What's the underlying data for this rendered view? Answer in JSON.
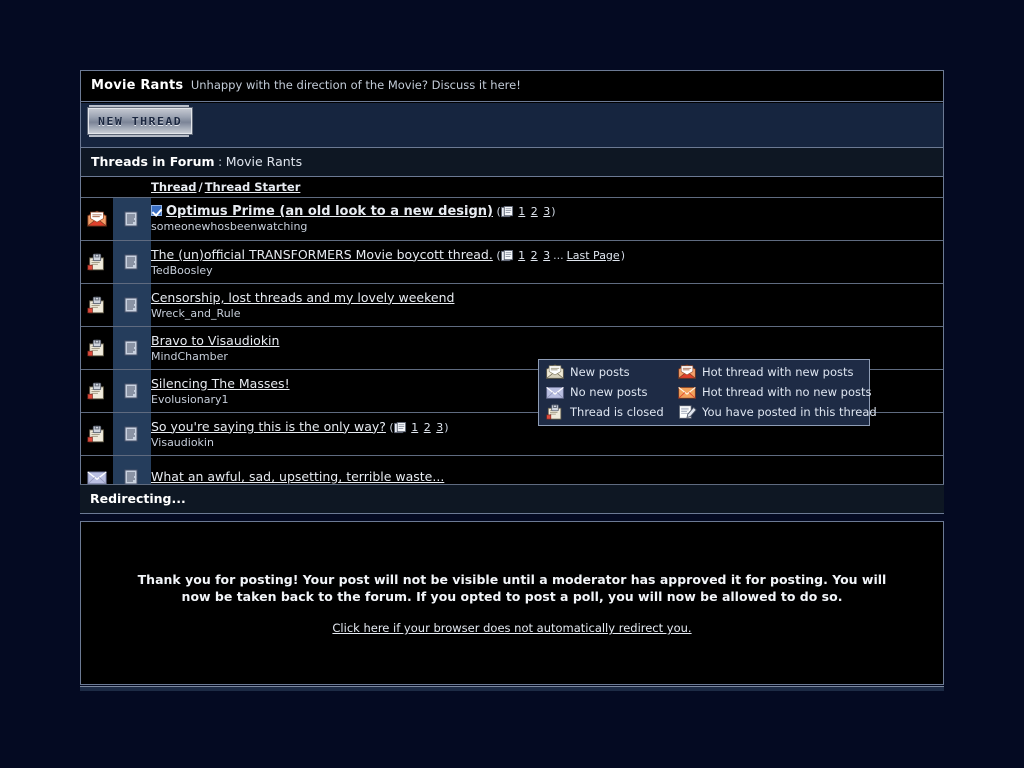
{
  "forum": {
    "name": "Movie Rants",
    "description": "Unhappy with the direction of the Movie? Discuss it here!",
    "new_thread_button": "NEW THREAD",
    "threads_header_label": "Threads in Forum",
    "threads_header_separator": ":",
    "threads_header_forum": "Movie Rants",
    "columns": {
      "thread": "Thread",
      "separator": "/",
      "thread_starter": "Thread Starter"
    },
    "threads": [
      {
        "status_icon": "hot-thread-new-posts-icon",
        "multipage_icon": "multipage-icon",
        "has_checkbox": true,
        "bold": true,
        "title": "Optimus Prime (an old look to a new design)",
        "starter": "someonewhosbeenwatching",
        "pages": [
          "1",
          "2",
          "3"
        ],
        "last_page": null
      },
      {
        "status_icon": "thread-closed-icon",
        "multipage_icon": "multipage-icon",
        "has_checkbox": false,
        "bold": false,
        "title": "The (un)official TRANSFORMERS Movie boycott thread.",
        "starter": "TedBoosley",
        "pages": [
          "1",
          "2",
          "3"
        ],
        "last_page": "Last Page"
      },
      {
        "status_icon": "thread-closed-icon",
        "multipage_icon": "multipage-icon",
        "has_checkbox": false,
        "bold": false,
        "title": "Censorship, lost threads and my lovely weekend",
        "starter": "Wreck_and_Rule",
        "pages": [],
        "last_page": null
      },
      {
        "status_icon": "thread-closed-icon",
        "multipage_icon": "multipage-icon",
        "has_checkbox": false,
        "bold": false,
        "title": "Bravo to Visaudiokin",
        "starter": "MindChamber",
        "pages": [],
        "last_page": null
      },
      {
        "status_icon": "thread-closed-icon",
        "multipage_icon": "multipage-icon",
        "has_checkbox": false,
        "bold": false,
        "title": "Silencing The Masses!",
        "starter": "Evolusionary1",
        "pages": [],
        "last_page": null
      },
      {
        "status_icon": "thread-closed-icon",
        "multipage_icon": "multipage-icon",
        "has_checkbox": false,
        "bold": false,
        "title": "So you're saying this is the only way?",
        "starter": "Visaudiokin",
        "pages": [
          "1",
          "2",
          "3"
        ],
        "last_page": null
      },
      {
        "status_icon": "no-new-posts-icon",
        "multipage_icon": "multipage-icon",
        "has_checkbox": false,
        "bold": false,
        "title": "What an awful, sad, upsetting, terrible waste...",
        "starter": "",
        "pages": [],
        "last_page": null
      }
    ]
  },
  "legend": {
    "items": [
      {
        "icon": "new-posts-icon",
        "label": "New posts"
      },
      {
        "icon": "hot-thread-new-posts-icon",
        "label": "Hot thread with new posts"
      },
      {
        "icon": "no-new-posts-icon",
        "label": "No new posts"
      },
      {
        "icon": "hot-thread-no-new-posts-icon",
        "label": "Hot thread with no new posts"
      },
      {
        "icon": "thread-closed-icon",
        "label": "Thread is closed"
      },
      {
        "icon": "you-posted-icon",
        "label": "You have posted in this thread"
      }
    ]
  },
  "redirect": {
    "title": "Redirecting...",
    "message": "Thank you for posting! Your post will not be visible until a moderator has approved it for posting. You will now be taken back to the forum. If you opted to post a poll, you will now be allowed to do so.",
    "link": "Click here if your browser does not automatically redirect you."
  },
  "colors": {
    "page_background": "#040A22",
    "panel_background": "#000000",
    "toolbar_background": "#16253F",
    "header_background": "#0E1723",
    "icon_column_background": "#253D5C",
    "legend_background": "#1E2B45",
    "border": "#6C7A94",
    "text": "#E8ECF2",
    "accent_checkbox": "#3A6FC4"
  }
}
